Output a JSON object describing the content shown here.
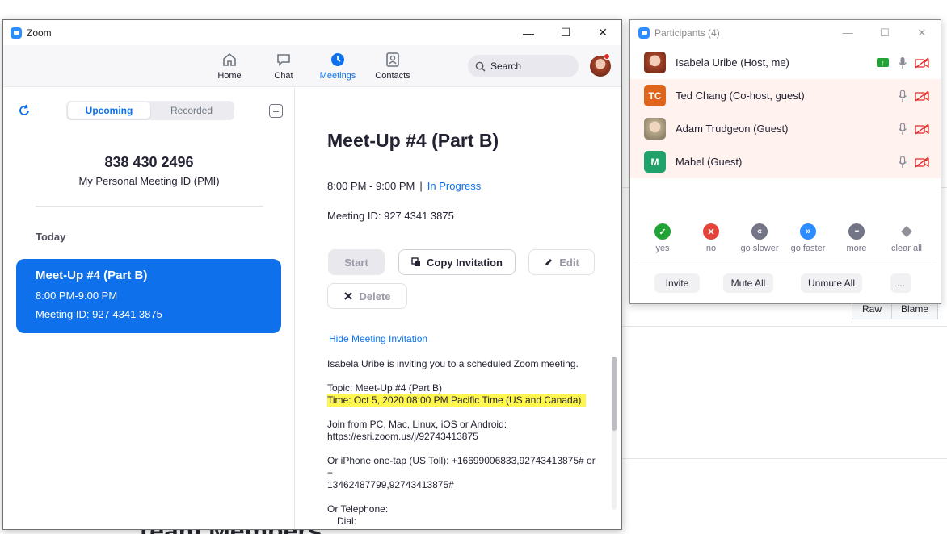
{
  "zoom": {
    "window_title": "Zoom",
    "nav": [
      {
        "label": "Home",
        "icon": "home-icon",
        "active": false
      },
      {
        "label": "Chat",
        "icon": "chat-icon",
        "active": false
      },
      {
        "label": "Meetings",
        "icon": "clock-icon",
        "active": true
      },
      {
        "label": "Contacts",
        "icon": "contacts-icon",
        "active": false
      }
    ],
    "search_label": "Search",
    "tabs": {
      "upcoming": "Upcoming",
      "recorded": "Recorded"
    },
    "pmi": {
      "number": "838 430 2496",
      "label": "My Personal Meeting ID (PMI)"
    },
    "today_label": "Today",
    "meeting_card": {
      "title": "Meet-Up #4 (Part B)",
      "time": "8:00 PM-9:00 PM",
      "meeting_id": "Meeting ID: 927 4341 3875"
    },
    "detail": {
      "title": "Meet-Up #4 (Part B)",
      "time": "8:00 PM - 9:00 PM",
      "separator": "|",
      "status": "In Progress",
      "meeting_id": "Meeting ID: 927 4341 3875",
      "buttons": {
        "start": "Start",
        "copy": "Copy Invitation",
        "edit": "Edit",
        "delete": "Delete"
      },
      "hide_invitation": "Hide Meeting Invitation",
      "invitation": {
        "line1": "Isabela Uribe is inviting you to a scheduled Zoom meeting.",
        "topic": "Topic: Meet-Up #4 (Part B)",
        "time": "Time: Oct 5, 2020 08:00 PM Pacific Time (US and Canada)",
        "join_from": "Join from PC, Mac, Linux, iOS or Android:",
        "join_url": "https://esri.zoom.us/j/92743413875",
        "iphone_1": "Or iPhone one-tap (US Toll):  +16699006833,92743413875#  or +",
        "iphone_2": "13462487799,92743413875#",
        "telephone": "Or Telephone:",
        "dial": "Dial:"
      }
    }
  },
  "participants": {
    "title": "Participants (4)",
    "list": [
      {
        "name": "Isabela Uribe (Host, me)",
        "avatar_initials": "",
        "avatar_color": "#c9785e"
      },
      {
        "name": "Ted Chang (Co-host, guest)",
        "avatar_initials": "TC",
        "avatar_color": "#e0651c"
      },
      {
        "name": "Adam Trudgeon (Guest)",
        "avatar_initials": "",
        "avatar_color": "#b7a98a"
      },
      {
        "name": "Mabel (Guest)",
        "avatar_initials": "M",
        "avatar_color": "#1fa36b"
      }
    ],
    "reactions": [
      {
        "label": "yes",
        "symbol": "✓",
        "color": "#22a335"
      },
      {
        "label": "no",
        "symbol": "✕",
        "color": "#e8433b"
      },
      {
        "label": "go slower",
        "symbol": "«",
        "color": "#747487"
      },
      {
        "label": "go faster",
        "symbol": "»",
        "color": "#2d8cff"
      },
      {
        "label": "more",
        "symbol": "•••",
        "color": "#747487"
      },
      {
        "label": "clear all",
        "symbol": "",
        "color": "#909098"
      }
    ],
    "buttons": {
      "invite": "Invite",
      "mute_all": "Mute All",
      "unmute_all": "Unmute All",
      "more": "..."
    }
  },
  "background": {
    "raw": "Raw",
    "blame": "Blame",
    "heading": "Team Members"
  }
}
